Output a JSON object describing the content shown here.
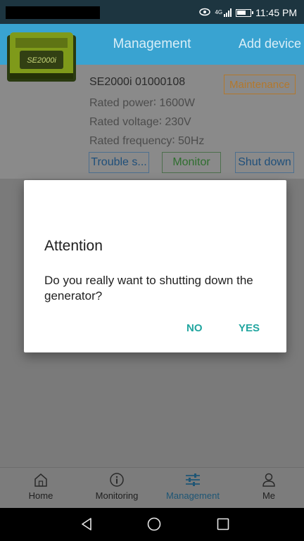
{
  "status_bar": {
    "time": "11:45 PM",
    "network_label": "4G",
    "icons": [
      "eye-icon",
      "signal-icon",
      "battery-icon"
    ]
  },
  "app_bar": {
    "title": "Management",
    "add_device": "Add device",
    "color": "#39a3d1"
  },
  "device_card": {
    "name": "SE2000i 01000108",
    "rated_power": "Rated power∶ 1600W",
    "rated_voltage": "Rated voltage∶ 230V",
    "rated_frequency": "Rated frequency∶ 50Hz",
    "status_badge": "Maintenance",
    "product_label": "SE2000i",
    "buttons": {
      "trouble": "Trouble s...",
      "monitor": "Monitor",
      "shutdown": "Shut down"
    }
  },
  "dialog": {
    "title": "Attention",
    "message": "Do you really want to shutting down the generator?",
    "no": "NO",
    "yes": "YES"
  },
  "bottom_nav": {
    "items": [
      {
        "label": "Home",
        "icon": "home-icon"
      },
      {
        "label": "Monitoring",
        "icon": "info-icon"
      },
      {
        "label": "Management",
        "icon": "sliders-icon",
        "active": true
      },
      {
        "label": "Me",
        "icon": "person-icon"
      }
    ]
  },
  "system_nav": {
    "icons": [
      "back-icon",
      "home-circle-icon",
      "recents-icon"
    ]
  },
  "colors": {
    "accent": "#22a6a0",
    "maintenance": "#b3782c"
  }
}
